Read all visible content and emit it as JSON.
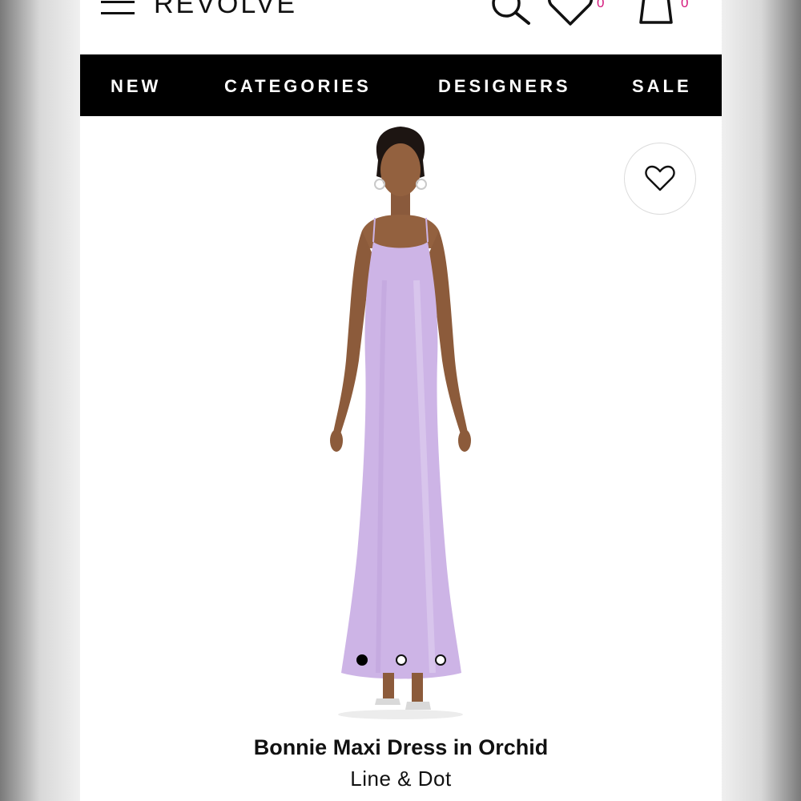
{
  "header": {
    "logo": "REVOLVE",
    "wishlist_count": "0",
    "bag_count": "0",
    "accent_color": "#d4147a"
  },
  "nav": {
    "items": [
      {
        "label": "NEW"
      },
      {
        "label": "CATEGORIES"
      },
      {
        "label": "DESIGNERS"
      },
      {
        "label": "SALE"
      }
    ]
  },
  "product": {
    "name": "Bonnie Maxi Dress in Orchid",
    "brand": "Line & Dot",
    "dress_color": "#cdb4e6",
    "gallery": {
      "image_count": 3,
      "active_index": 0
    }
  },
  "icons": {
    "menu": "hamburger-icon",
    "search": "search-icon",
    "wishlist": "heart-icon",
    "bag": "shopping-bag-icon",
    "add_to_wishlist": "heart-outline-icon"
  }
}
